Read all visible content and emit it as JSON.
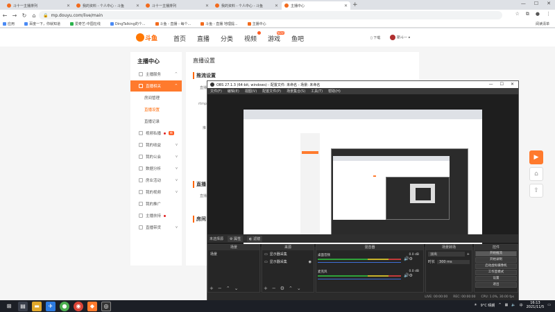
{
  "browser": {
    "tabs": [
      {
        "title": "斗十一主播排列"
      },
      {
        "title": "我的资料 - 个人中心 - 斗鱼"
      },
      {
        "title": "斗十一主播排列"
      },
      {
        "title": "我的资料 - 个人中心 - 斗鱼"
      },
      {
        "title": "主播中心"
      }
    ],
    "new_tab": "+",
    "url": "mp.douyu.com/live/main",
    "bookmarks": [
      "应用",
      "百度一下，你就知道",
      "爱奇艺-中国在线",
      "DingTalking的个...",
      "斗鱼 - 直播 - 每个...",
      "斗鱼 - 直播 地理提...",
      "主播中心"
    ],
    "bookmarks_right": "阅读清单"
  },
  "douyu": {
    "brand": "斗鱼",
    "nav": [
      "首页",
      "直播",
      "分类",
      "视频",
      "游戏",
      "鱼吧"
    ],
    "nav_badges": {
      "video": "",
      "game": "NEW"
    },
    "header_right": {
      "download": "下载",
      "user": "斯斗一"
    },
    "sidebar": {
      "title": "主播中心",
      "items": [
        {
          "label": "主播服务",
          "dot": false
        },
        {
          "label": "直播相关",
          "dot": false
        },
        {
          "label": "视频私播",
          "dot": true
        },
        {
          "label": "我的收益",
          "dot": false
        },
        {
          "label": "我的公会",
          "dot": false
        },
        {
          "label": "数据分析",
          "dot": false
        },
        {
          "label": "房业活动",
          "dot": false
        },
        {
          "label": "我的视频",
          "dot": false
        },
        {
          "label": "我的推广",
          "dot": false
        },
        {
          "label": "主播扶持",
          "dot": true
        },
        {
          "label": "直播带货",
          "dot": false
        }
      ],
      "subitems": [
        "房间管理",
        "直播设置",
        "直播记录"
      ],
      "hot_badge": "新"
    },
    "main": {
      "title": "直播设置",
      "section_push": "推流设置",
      "section_live": "直播",
      "section_room": "房间",
      "labels": [
        "直播",
        "rtmp",
        "推",
        "直播"
      ]
    }
  },
  "obs": {
    "title": "OBS 27.1.3 (64-bit, windows) - 配置文件: 未命名 - 场景: 未命名",
    "menu": [
      "文件(F)",
      "编辑(E)",
      "视图(V)",
      "配置文件(P)",
      "场景集合(S)",
      "工具(T)",
      "帮助(H)"
    ],
    "toolbar": {
      "label": "未选择源",
      "properties": "属性",
      "filters": "滤镜"
    },
    "docks": {
      "scenes": {
        "title": "场景",
        "items": [
          "场景"
        ]
      },
      "sources": {
        "title": "来源",
        "items": [
          "显示器采集",
          "显示器采集"
        ]
      },
      "mixer": {
        "title": "混音器",
        "channels": [
          {
            "name": "桌面音频",
            "level": "0.0 dB"
          },
          {
            "name": "麦克风",
            "level": "0.0 dB"
          }
        ]
      },
      "transitions": {
        "title": "场景转场",
        "type": "淡出",
        "duration_label": "时长",
        "duration": "300 ms"
      },
      "controls": {
        "title": "控件",
        "buttons": [
          "开始推流",
          "开始录制",
          "启动虚拟摄像机",
          "工作室模式",
          "设置",
          "退出"
        ]
      }
    },
    "status": {
      "live": "LIVE: 00:00:00",
      "rec": "REC: 00:00:00",
      "cpu": "CPU: 1.0%, 30.00 fps"
    }
  },
  "taskbar": {
    "weather": "9°C 晴朗",
    "time": "16:13",
    "date": "2021/11/5",
    "lang": "中"
  },
  "colors": {
    "accent": "#ff7a2d",
    "obs_bg": "#2b2b2b"
  }
}
